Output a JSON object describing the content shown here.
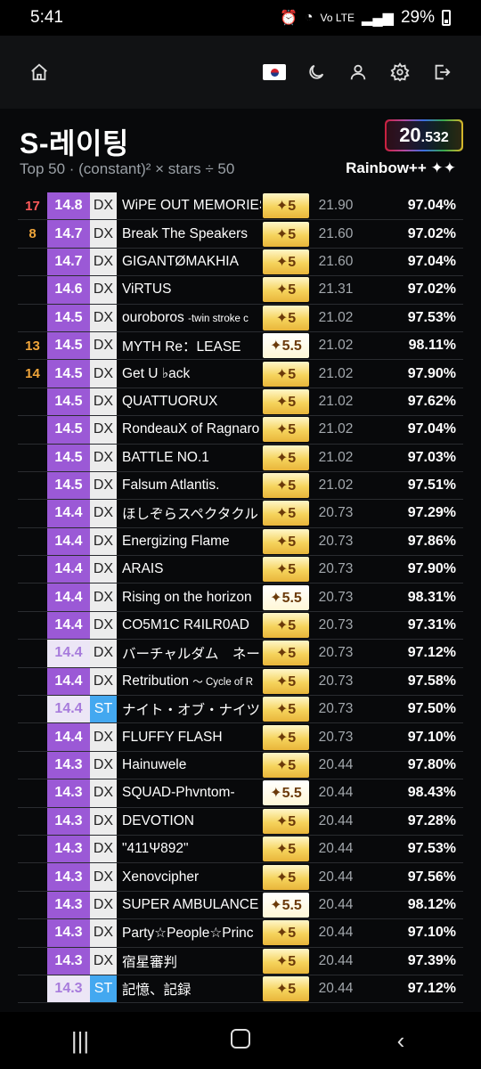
{
  "status": {
    "time": "5:41",
    "network": "Vo LTE",
    "battery": "29%"
  },
  "nav": {
    "flag_icon": "korean-flag-icon"
  },
  "panel": {
    "title": "S-레이팅",
    "subtitle": "Top 50 · (constant)² × stars ÷ 50",
    "rating_int": "20",
    "rating_dec": ".532",
    "rank_name": "Rainbow++ ✦✦"
  },
  "rows": [
    {
      "rank": "17",
      "rank_color": "red",
      "level": "14.8",
      "level_style": "ma",
      "kind": "DX",
      "song": "WiPE OUT MEMORIES",
      "song_small": "",
      "stars": "✦5",
      "stars_style": "gold",
      "const": "21.90",
      "acc": "97.04%"
    },
    {
      "rank": "8",
      "rank_color": "orange",
      "level": "14.7",
      "level_style": "ma",
      "kind": "DX",
      "song": "Break The Speakers",
      "song_small": "",
      "stars": "✦5",
      "stars_style": "gold",
      "const": "21.60",
      "acc": "97.02%"
    },
    {
      "rank": "",
      "rank_color": "orange",
      "level": "14.7",
      "level_style": "ma",
      "kind": "DX",
      "song": "GIGANTØMAKHIA",
      "song_small": "",
      "stars": "✦5",
      "stars_style": "gold",
      "const": "21.60",
      "acc": "97.04%"
    },
    {
      "rank": "",
      "rank_color": "orange",
      "level": "14.6",
      "level_style": "ma",
      "kind": "DX",
      "song": "ViRTUS",
      "song_small": "",
      "stars": "✦5",
      "stars_style": "gold",
      "const": "21.31",
      "acc": "97.02%"
    },
    {
      "rank": "",
      "rank_color": "orange",
      "level": "14.5",
      "level_style": "ma",
      "kind": "DX",
      "song": "ouroboros ",
      "song_small": "-twin stroke c",
      "stars": "✦5",
      "stars_style": "gold",
      "const": "21.02",
      "acc": "97.53%"
    },
    {
      "rank": "13",
      "rank_color": "orange",
      "level": "14.5",
      "level_style": "ma",
      "kind": "DX",
      "song": "MYTH Re：LEASE",
      "song_small": "",
      "stars": "✦5.5",
      "stars_style": "ex",
      "const": "21.02",
      "acc": "98.11%"
    },
    {
      "rank": "14",
      "rank_color": "orange",
      "level": "14.5",
      "level_style": "ma",
      "kind": "DX",
      "song": "Get U ♭ack",
      "song_small": "",
      "stars": "✦5",
      "stars_style": "gold",
      "const": "21.02",
      "acc": "97.90%"
    },
    {
      "rank": "",
      "rank_color": "orange",
      "level": "14.5",
      "level_style": "ma",
      "kind": "DX",
      "song": "QUATTUORUX",
      "song_small": "",
      "stars": "✦5",
      "stars_style": "gold",
      "const": "21.02",
      "acc": "97.62%"
    },
    {
      "rank": "",
      "rank_color": "orange",
      "level": "14.5",
      "level_style": "ma",
      "kind": "DX",
      "song": "RondeauX of Ragnaro",
      "song_small": "",
      "stars": "✦5",
      "stars_style": "gold",
      "const": "21.02",
      "acc": "97.04%"
    },
    {
      "rank": "",
      "rank_color": "orange",
      "level": "14.5",
      "level_style": "ma",
      "kind": "DX",
      "song": "BATTLE NO.1",
      "song_small": "",
      "stars": "✦5",
      "stars_style": "gold",
      "const": "21.02",
      "acc": "97.03%"
    },
    {
      "rank": "",
      "rank_color": "orange",
      "level": "14.5",
      "level_style": "ma",
      "kind": "DX",
      "song": "Falsum Atlantis.",
      "song_small": "",
      "stars": "✦5",
      "stars_style": "gold",
      "const": "21.02",
      "acc": "97.51%"
    },
    {
      "rank": "",
      "rank_color": "orange",
      "level": "14.4",
      "level_style": "ma",
      "kind": "DX",
      "song": "ほしぞらスペクタクル",
      "song_small": "",
      "stars": "✦5",
      "stars_style": "gold",
      "const": "20.73",
      "acc": "97.29%"
    },
    {
      "rank": "",
      "rank_color": "orange",
      "level": "14.4",
      "level_style": "ma",
      "kind": "DX",
      "song": "Energizing Flame",
      "song_small": "",
      "stars": "✦5",
      "stars_style": "gold",
      "const": "20.73",
      "acc": "97.86%"
    },
    {
      "rank": "",
      "rank_color": "orange",
      "level": "14.4",
      "level_style": "ma",
      "kind": "DX",
      "song": "ARAIS",
      "song_small": "",
      "stars": "✦5",
      "stars_style": "gold",
      "const": "20.73",
      "acc": "97.90%"
    },
    {
      "rank": "",
      "rank_color": "orange",
      "level": "14.4",
      "level_style": "ma",
      "kind": "DX",
      "song": "Rising on the horizon",
      "song_small": "",
      "stars": "✦5.5",
      "stars_style": "ex",
      "const": "20.73",
      "acc": "98.31%"
    },
    {
      "rank": "",
      "rank_color": "orange",
      "level": "14.4",
      "level_style": "ma",
      "kind": "DX",
      "song": "CO5M1C R4ILR0AD",
      "song_small": "",
      "stars": "✦5",
      "stars_style": "gold",
      "const": "20.73",
      "acc": "97.31%"
    },
    {
      "rank": "",
      "rank_color": "orange",
      "level": "14.4",
      "level_style": "re",
      "kind": "DX",
      "song": "バーチャルダム　ネーシ",
      "song_small": "",
      "stars": "✦5",
      "stars_style": "gold",
      "const": "20.73",
      "acc": "97.12%"
    },
    {
      "rank": "",
      "rank_color": "orange",
      "level": "14.4",
      "level_style": "ma",
      "kind": "DX",
      "song": "Retribution ",
      "song_small": "～ Cycle of R",
      "stars": "✦5",
      "stars_style": "gold",
      "const": "20.73",
      "acc": "97.58%"
    },
    {
      "rank": "",
      "rank_color": "orange",
      "level": "14.4",
      "level_style": "re",
      "kind": "ST",
      "song": "ナイト・オブ・ナイツ",
      "song_small": "",
      "stars": "✦5",
      "stars_style": "gold",
      "const": "20.73",
      "acc": "97.50%"
    },
    {
      "rank": "",
      "rank_color": "orange",
      "level": "14.4",
      "level_style": "ma",
      "kind": "DX",
      "song": "FLUFFY FLASH",
      "song_small": "",
      "stars": "✦5",
      "stars_style": "gold",
      "const": "20.73",
      "acc": "97.10%"
    },
    {
      "rank": "",
      "rank_color": "orange",
      "level": "14.3",
      "level_style": "ma",
      "kind": "DX",
      "song": "Hainuwele",
      "song_small": "",
      "stars": "✦5",
      "stars_style": "gold",
      "const": "20.44",
      "acc": "97.80%"
    },
    {
      "rank": "",
      "rank_color": "orange",
      "level": "14.3",
      "level_style": "ma",
      "kind": "DX",
      "song": "SQUAD-Phvntom-",
      "song_small": "",
      "stars": "✦5.5",
      "stars_style": "ex",
      "const": "20.44",
      "acc": "98.43%"
    },
    {
      "rank": "",
      "rank_color": "orange",
      "level": "14.3",
      "level_style": "ma",
      "kind": "DX",
      "song": "DEVOTION",
      "song_small": "",
      "stars": "✦5",
      "stars_style": "gold",
      "const": "20.44",
      "acc": "97.28%"
    },
    {
      "rank": "",
      "rank_color": "orange",
      "level": "14.3",
      "level_style": "ma",
      "kind": "DX",
      "song": "\"411Ψ892\"",
      "song_small": "",
      "stars": "✦5",
      "stars_style": "gold",
      "const": "20.44",
      "acc": "97.53%"
    },
    {
      "rank": "",
      "rank_color": "orange",
      "level": "14.3",
      "level_style": "ma",
      "kind": "DX",
      "song": "Xenovcipher",
      "song_small": "",
      "stars": "✦5",
      "stars_style": "gold",
      "const": "20.44",
      "acc": "97.56%"
    },
    {
      "rank": "",
      "rank_color": "orange",
      "level": "14.3",
      "level_style": "ma",
      "kind": "DX",
      "song": "SUPER AMBULANCE",
      "song_small": "",
      "stars": "✦5.5",
      "stars_style": "ex",
      "const": "20.44",
      "acc": "98.12%"
    },
    {
      "rank": "",
      "rank_color": "orange",
      "level": "14.3",
      "level_style": "ma",
      "kind": "DX",
      "song": "Party☆People☆Princ",
      "song_small": "",
      "stars": "✦5",
      "stars_style": "gold",
      "const": "20.44",
      "acc": "97.10%"
    },
    {
      "rank": "",
      "rank_color": "orange",
      "level": "14.3",
      "level_style": "ma",
      "kind": "DX",
      "song": "宿星審判",
      "song_small": "",
      "stars": "✦5",
      "stars_style": "gold",
      "const": "20.44",
      "acc": "97.39%"
    },
    {
      "rank": "",
      "rank_color": "orange",
      "level": "14.3",
      "level_style": "re",
      "kind": "ST",
      "song": "記憶、記録",
      "song_small": "",
      "stars": "✦5",
      "stars_style": "gold",
      "const": "20.44",
      "acc": "97.12%"
    }
  ],
  "colors": {
    "master": "#9b59d6",
    "remaster_bg": "#ece6f6",
    "standard": "#43a8f0",
    "rank_orange": "#f0a53a",
    "rank_red": "#ff5a5a"
  }
}
